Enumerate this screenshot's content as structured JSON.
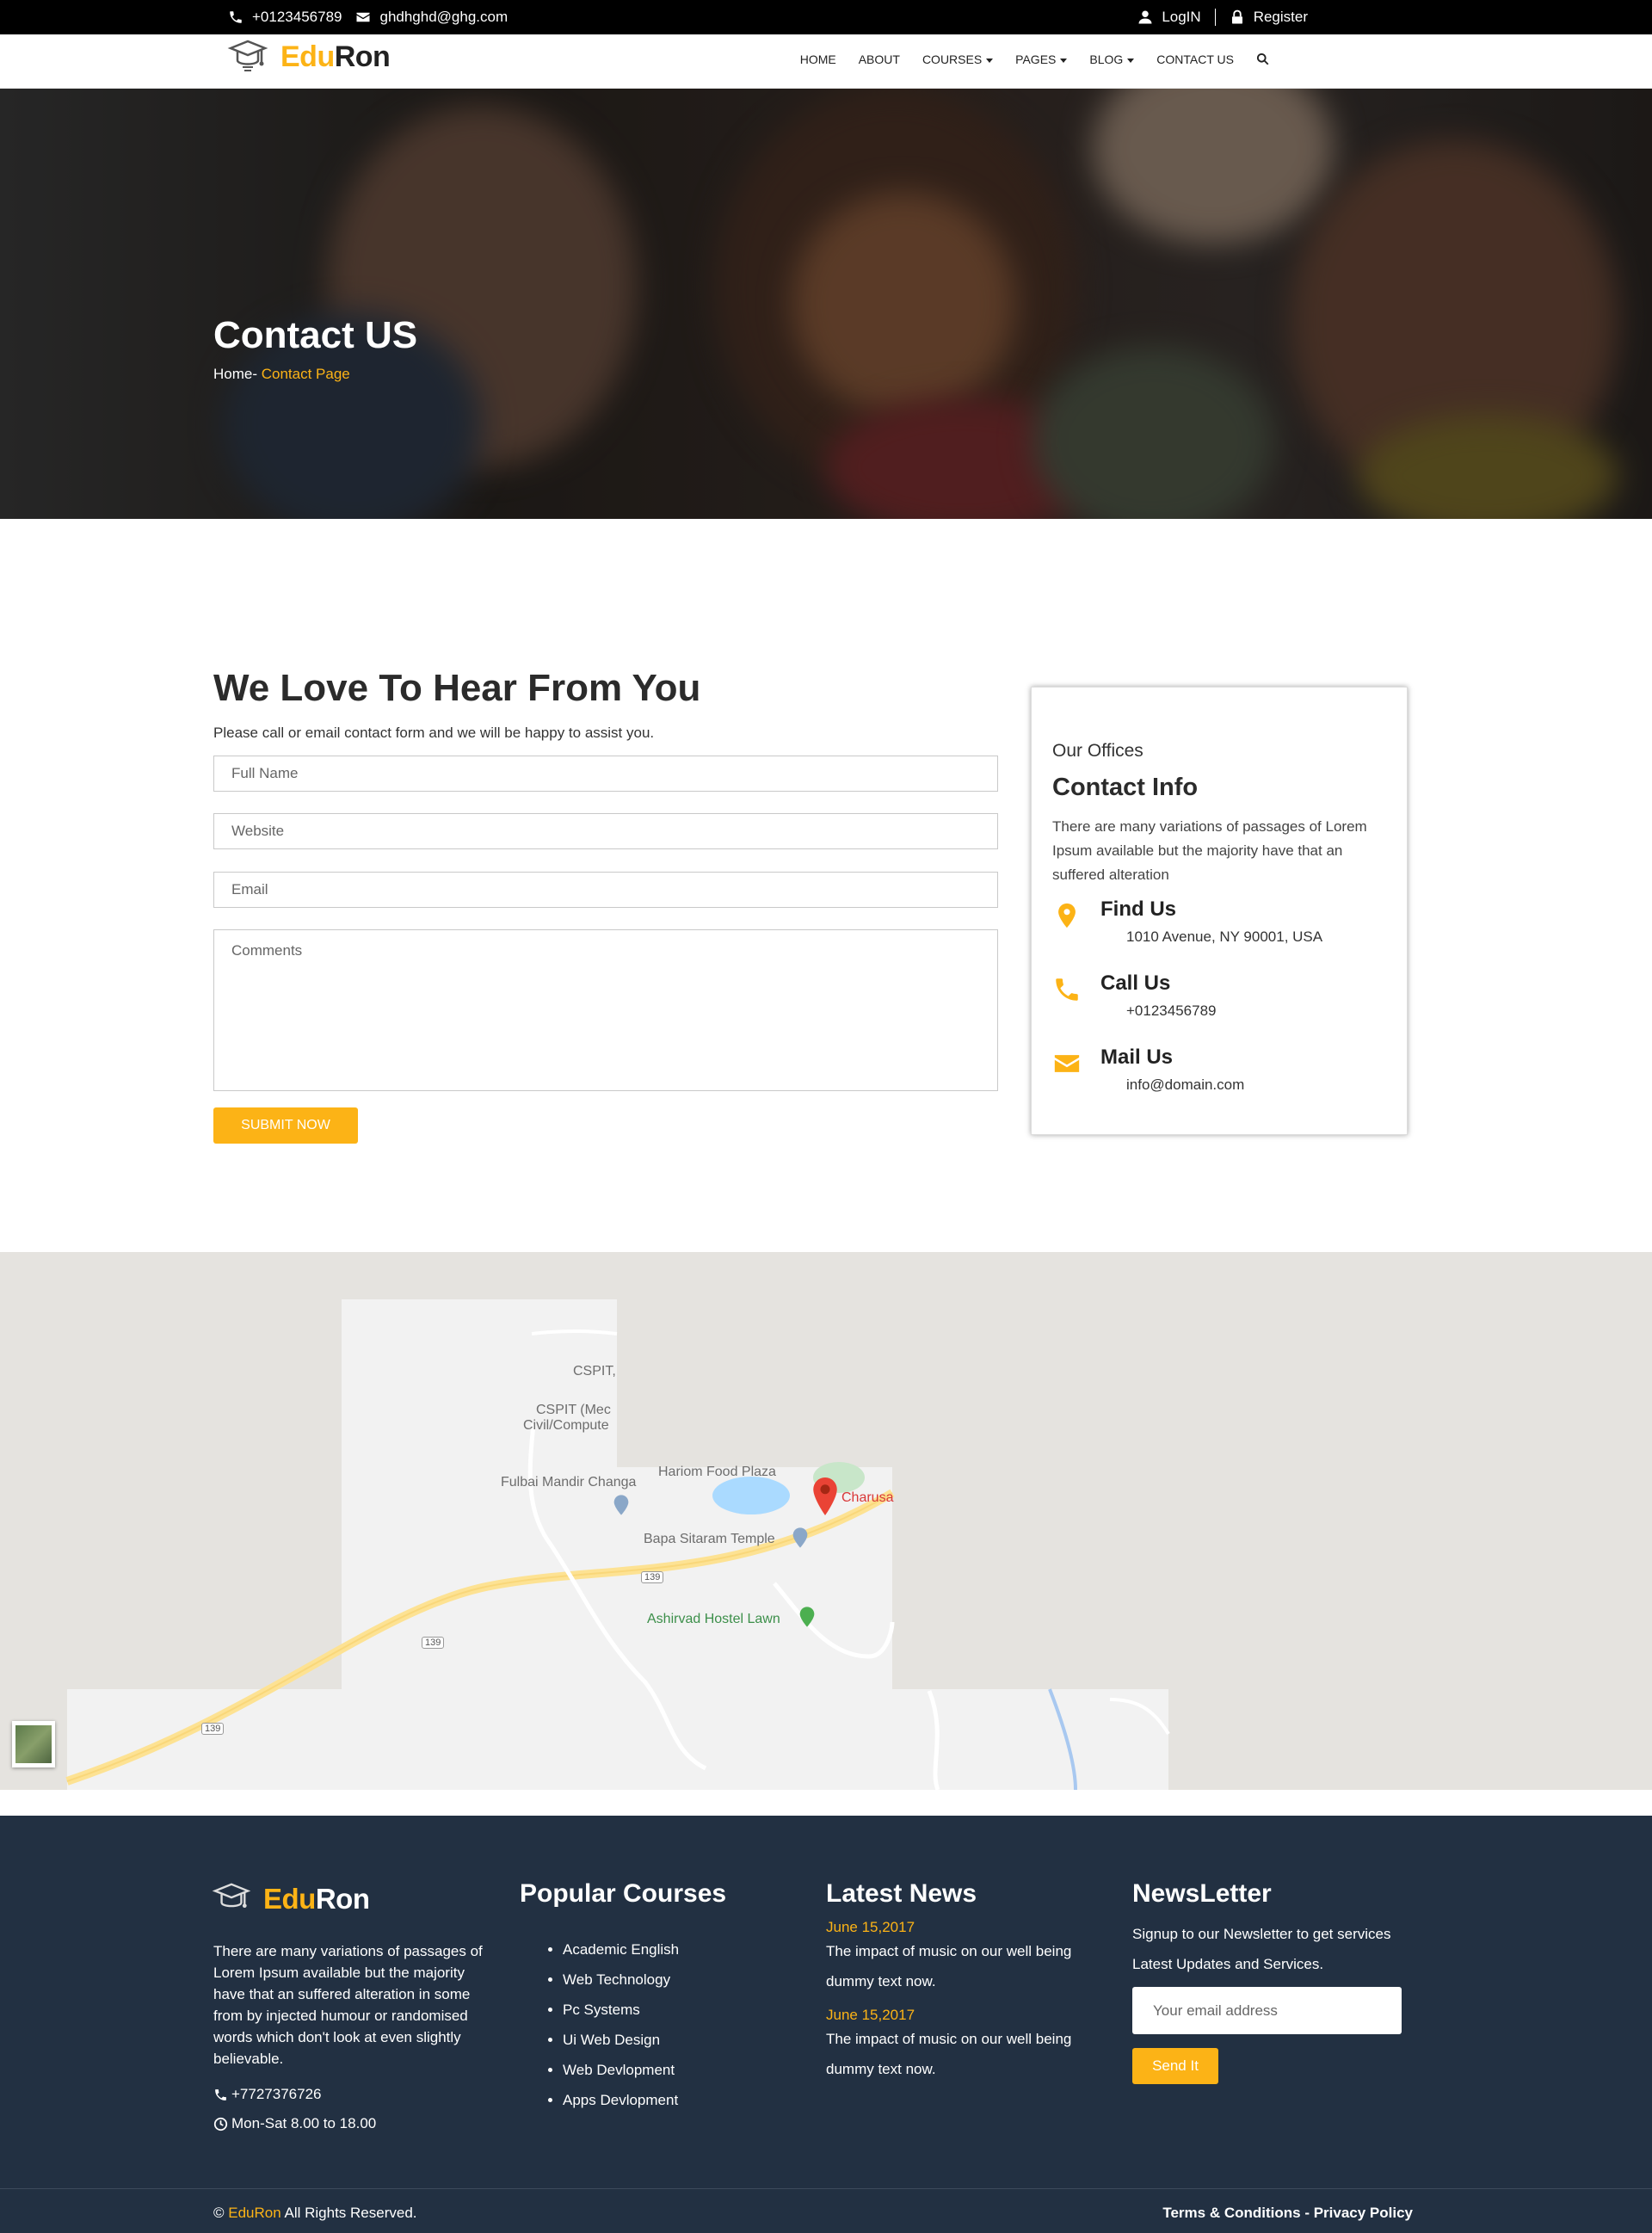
{
  "topbar": {
    "phone": "+0123456789",
    "email": "ghdhghd@ghg.com",
    "login_label": "LogIN",
    "register_label": "Register"
  },
  "brand": {
    "part1": "Edu",
    "part2": "Ron"
  },
  "nav": {
    "items": [
      "HOME",
      "ABOUT",
      "COURSES",
      "PAGES",
      "BLOG",
      "CONTACT US"
    ]
  },
  "hero": {
    "title": "Contact US",
    "breadcrumb_home": "Home-",
    "breadcrumb_current": " Contact Page"
  },
  "contact": {
    "heading": "We Love To Hear From You",
    "subheading": "Please call or email contact form and we will be happy to assist you.",
    "full_name_placeholder": "Full Name",
    "website_placeholder": "Website",
    "email_placeholder": "Email",
    "comments_placeholder": "Comments",
    "submit_label": "SUBMIT NOW"
  },
  "info_card": {
    "kicker": "Our Offices",
    "title": "Contact Info",
    "description": "There are many variations of passages of Lorem Ipsum available but the majority have that an suffered alteration",
    "find_title": "Find Us",
    "find_value": "1010 Avenue, NY 90001, USA",
    "call_title": "Call Us",
    "call_value": "+0123456789",
    "mail_title": "Mail Us",
    "mail_value": "info@domain.com"
  },
  "map": {
    "labels": [
      "CSPIT,",
      "CSPIT (Mec",
      "Civil/Compute",
      "Hariom Food Plaza",
      "Fulbai Mandir Changa",
      "Charusa",
      "Bapa Sitaram Temple",
      "Ashirvad Hostel Lawn"
    ],
    "road_shields": [
      "139",
      "139",
      "139"
    ]
  },
  "footer": {
    "about": "There are many variations of passages of Lorem Ipsum available but the majority have that an suffered alteration in some from by injected humour or randomised words which don't look at even slightly believable.",
    "phone": "+7727376726",
    "hours": "Mon-Sat 8.00 to 18.00",
    "courses_title": "Popular Courses",
    "courses": [
      "Academic English",
      "Web Technology",
      "Pc Systems",
      "Ui Web Design",
      "Web Devlopment",
      "Apps Devlopment"
    ],
    "news_title": "Latest News",
    "news": [
      {
        "date": "June 15,2017",
        "text": "The impact of music on our well being dummy text now."
      },
      {
        "date": "June 15,2017",
        "text": "The impact of music on our well being dummy text now."
      }
    ],
    "newsletter_title": "NewsLetter",
    "newsletter_text": "Signup to our Newsletter to get services Latest Updates and Services.",
    "newsletter_placeholder": "Your email address",
    "newsletter_button": "Send It",
    "copyright_symbol": "©",
    "copyright_brand": "EduRon",
    "copyright_rest": " All Rights Reserved.",
    "legal": "Terms & Conditions - Privacy Policy"
  },
  "colors": {
    "accent": "#fcb316",
    "footer_bg": "#223042",
    "topbar_bg": "#000000"
  }
}
